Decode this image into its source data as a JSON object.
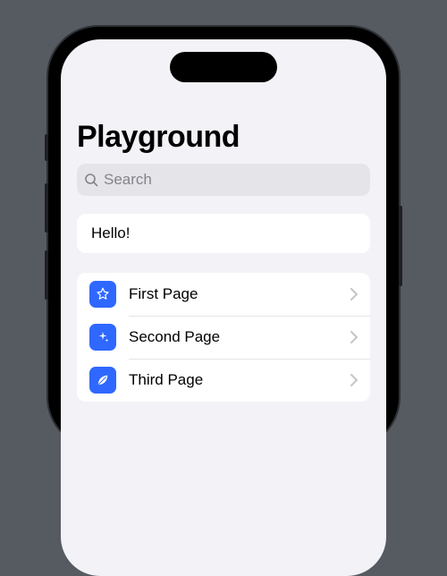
{
  "title": "Playground",
  "search": {
    "placeholder": "Search"
  },
  "greeting": "Hello!",
  "pages": [
    {
      "label": "First Page",
      "icon": "star-icon"
    },
    {
      "label": "Second Page",
      "icon": "sparkle-icon"
    },
    {
      "label": "Third Page",
      "icon": "leaf-icon"
    }
  ],
  "colors": {
    "accent": "#2f68ff",
    "bg": "#f2f2f7"
  }
}
